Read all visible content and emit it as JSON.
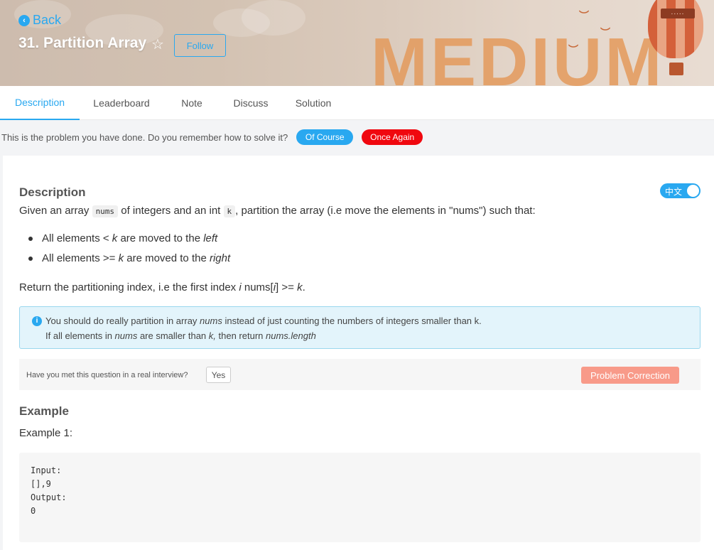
{
  "header": {
    "back_label": "Back",
    "title": "31. Partition Array",
    "follow_label": "Follow",
    "difficulty_art": "MEDIUM",
    "balloon_band": "....."
  },
  "tabs": [
    {
      "label": "Description",
      "active": true
    },
    {
      "label": "Leaderboard",
      "active": false
    },
    {
      "label": "Note",
      "active": false
    },
    {
      "label": "Discuss",
      "active": false
    },
    {
      "label": "Solution",
      "active": false
    }
  ],
  "done_bar": {
    "text": "This is the problem you have done. Do you remember how to solve it?",
    "of_course_label": "Of Course",
    "once_again_label": "Once Again"
  },
  "description": {
    "heading": "Description",
    "lang_toggle": "中文",
    "intro_pre": "Given an array",
    "intro_code1": "nums",
    "intro_mid": "of integers and an int",
    "intro_code2": "k",
    "intro_post": ", partition the array (i.e move the elements in \"nums\") such that:",
    "bullet1_pre": "All elements < ",
    "bullet1_var": "k",
    "bullet1_mid": " are moved to the ",
    "bullet1_end": "left",
    "bullet2_pre": "All elements >= ",
    "bullet2_var": "k",
    "bullet2_mid": " are moved to the ",
    "bullet2_end": "right",
    "return_pre": "Return the partitioning index, i.e the first index ",
    "return_i": "i",
    "return_mid": " nums[",
    "return_i2": "i",
    "return_end": "] >= ",
    "return_k": "k",
    "return_dot": "."
  },
  "info": {
    "l1_pre": "You should do really partition in array ",
    "l1_em": "nums",
    "l1_post": " instead of just counting the numbers of integers smaller than k.",
    "l2_pre": "If all elements in ",
    "l2_em1": "nums",
    "l2_mid": " are smaller than ",
    "l2_em2": "k,",
    "l2_mid2": " then return ",
    "l2_em3": "nums.length"
  },
  "meet": {
    "question": "Have you met this question in a real interview?",
    "yes_label": "Yes",
    "correction_label": "Problem Correction"
  },
  "example": {
    "heading": "Example",
    "sub": "Example 1:",
    "lines": [
      "Input:",
      "[],9",
      "Output:",
      "0"
    ]
  },
  "colors": {
    "accent": "#29a8f0",
    "danger": "#f0080f",
    "correction": "#f89a89"
  }
}
